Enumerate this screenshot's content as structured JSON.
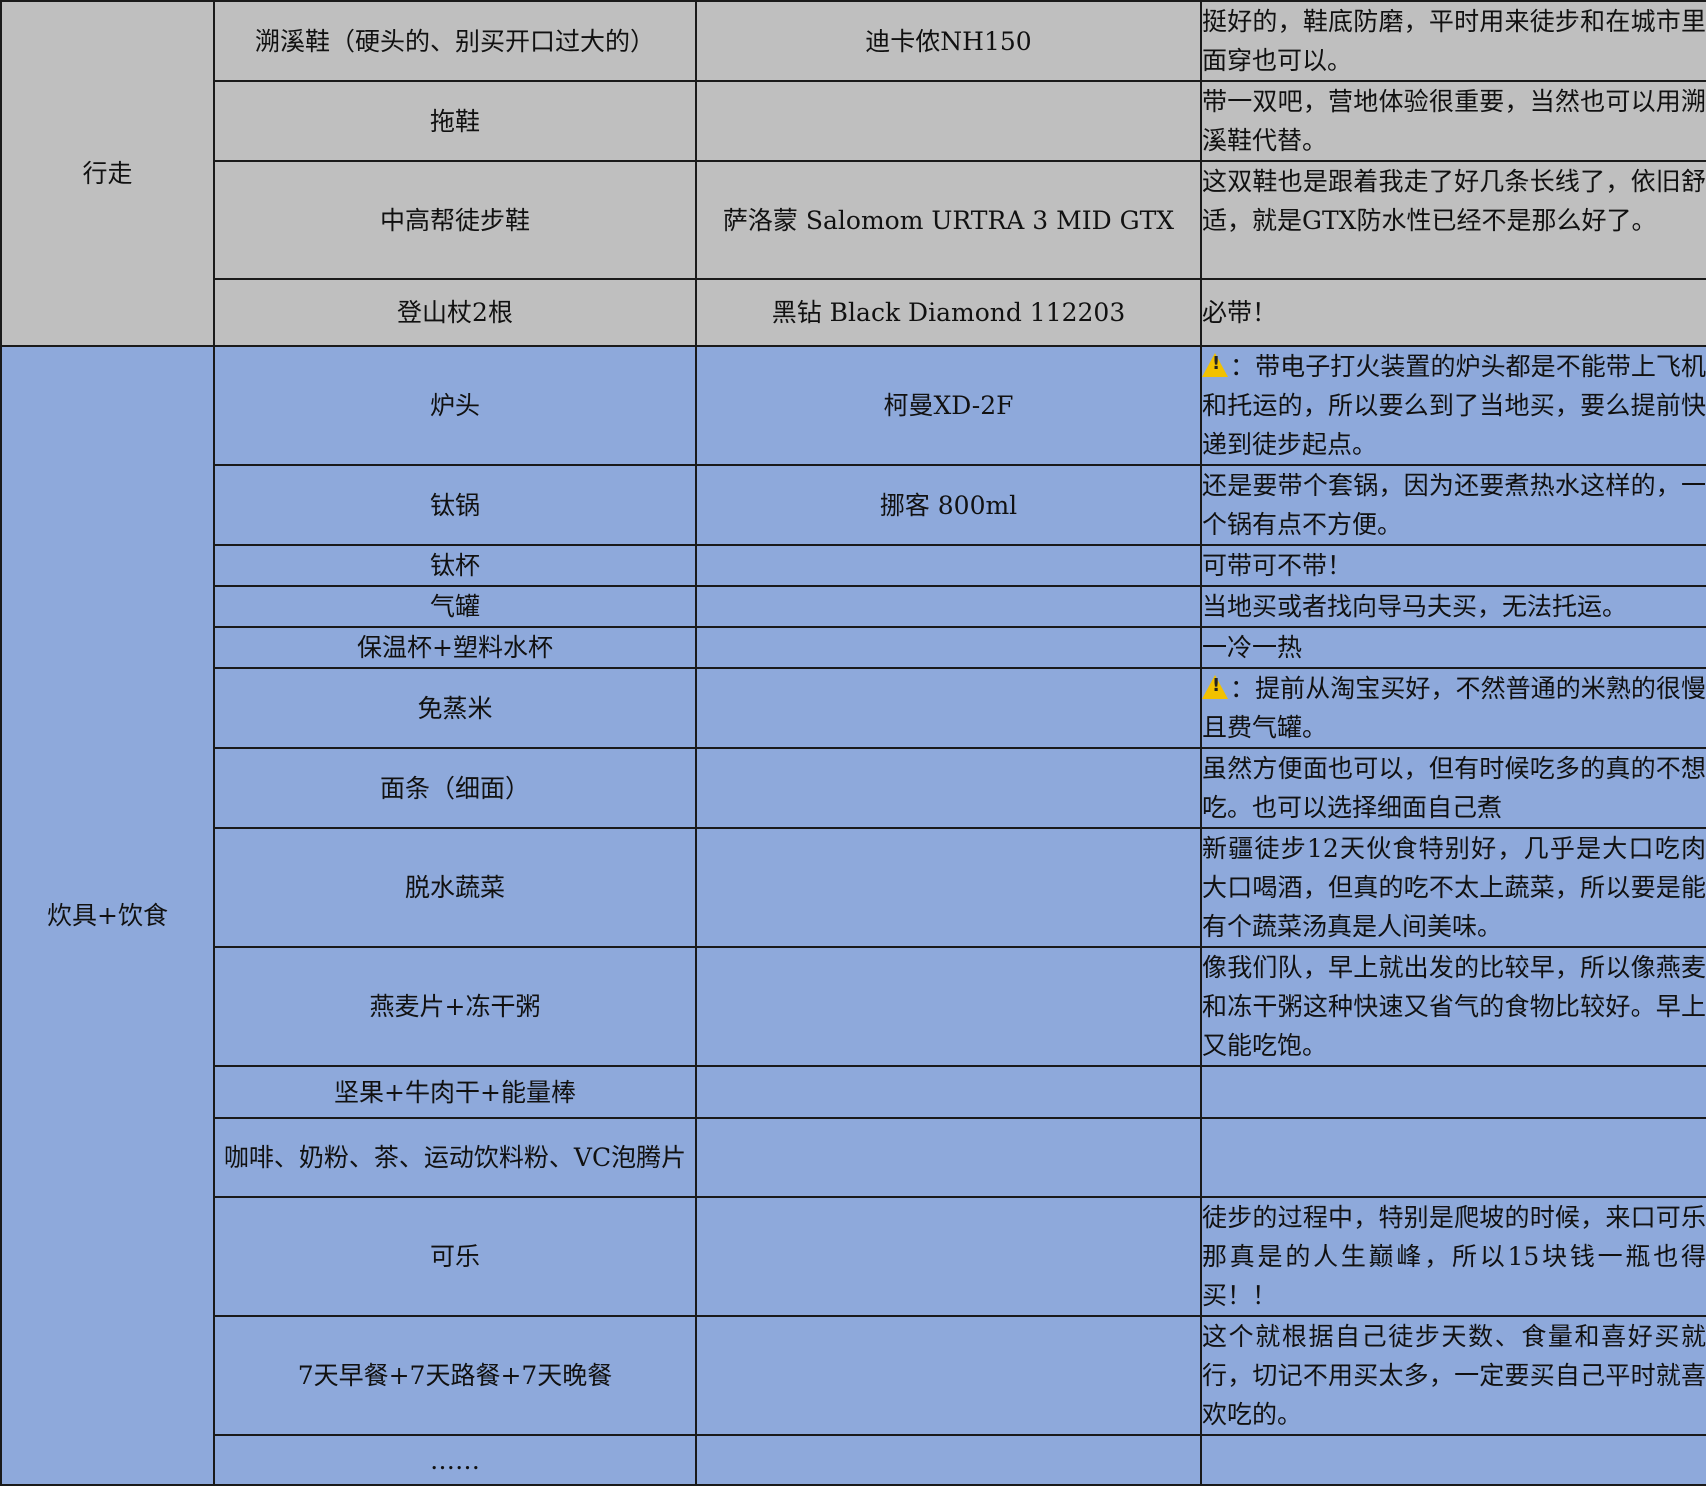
{
  "walk": {
    "category": "行走",
    "rows": [
      {
        "item": "溯溪鞋（硬头的、别买开口过大的）",
        "brand": "迪卡侬NH150",
        "note": "挺好的，鞋底防磨，平时用来徒步和在城市里面穿也可以。"
      },
      {
        "item": "拖鞋",
        "brand": "",
        "note": "带一双吧，营地体验很重要，当然也可以用溯溪鞋代替。"
      },
      {
        "item": "中高帮徒步鞋",
        "brand": "萨洛蒙 Salomom URTRA 3  MID GTX",
        "note": "这双鞋也是跟着我走了好几条长线了，依旧舒适，就是GTX防水性已经不是那么好了。"
      },
      {
        "item": "登山杖2根",
        "brand": "黑钻 Black Diamond 112203",
        "note": "必带！"
      }
    ]
  },
  "food": {
    "category": "炊具+饮食",
    "rows": [
      {
        "item": "炉头",
        "brand": "柯曼XD-2F",
        "note": "：带电子打火装置的炉头都是不能带上飞机和托运的，所以要么到了当地买，要么提前快递到徒步起点。",
        "warn_icon": "warning-icon"
      },
      {
        "item": "钛锅",
        "brand": "挪客 800ml",
        "note": "还是要带个套锅，因为还要煮热水这样的，一个锅有点不方便。"
      },
      {
        "item": "钛杯",
        "brand": "",
        "note": "可带可不带！"
      },
      {
        "item": "气罐",
        "brand": "",
        "note": "当地买或者找向导马夫买，无法托运。"
      },
      {
        "item": "保温杯+塑料水杯",
        "brand": "",
        "note": "一冷一热"
      },
      {
        "item": "免蒸米",
        "brand": "",
        "note": "：提前从淘宝买好，不然普通的米熟的很慢且费气罐。",
        "warn_icon": "warning-icon"
      },
      {
        "item": "面条（细面）",
        "brand": "",
        "note": "虽然方便面也可以，但有时候吃多的真的不想吃。也可以选择细面自己煮"
      },
      {
        "item": "脱水蔬菜",
        "brand": "",
        "note": "新疆徒步12天伙食特别好，几乎是大口吃肉大口喝酒，但真的吃不太上蔬菜，所以要是能有个蔬菜汤真是人间美味。"
      },
      {
        "item": "燕麦片+冻干粥",
        "brand": "",
        "note": "像我们队，早上就出发的比较早，所以像燕麦和冻干粥这种快速又省气的食物比较好。早上又能吃饱。"
      },
      {
        "item": "坚果+牛肉干+能量棒",
        "brand": "",
        "note": ""
      },
      {
        "item": "咖啡、奶粉、茶、运动饮料粉、VC泡腾片",
        "brand": "",
        "note": ""
      },
      {
        "item": "可乐",
        "brand": "",
        "note": "徒步的过程中，特别是爬坡的时候，来口可乐那真是的人生巅峰，所以15块钱一瓶也得买！！"
      },
      {
        "item": "7天早餐+7天路餐+7天晚餐",
        "brand": "",
        "note": "这个就根据自己徒步天数、食量和喜好买就行，切记不用买太多，一定要买自己平时就喜欢吃的。"
      },
      {
        "item": "……",
        "brand": "",
        "note": ""
      }
    ]
  }
}
